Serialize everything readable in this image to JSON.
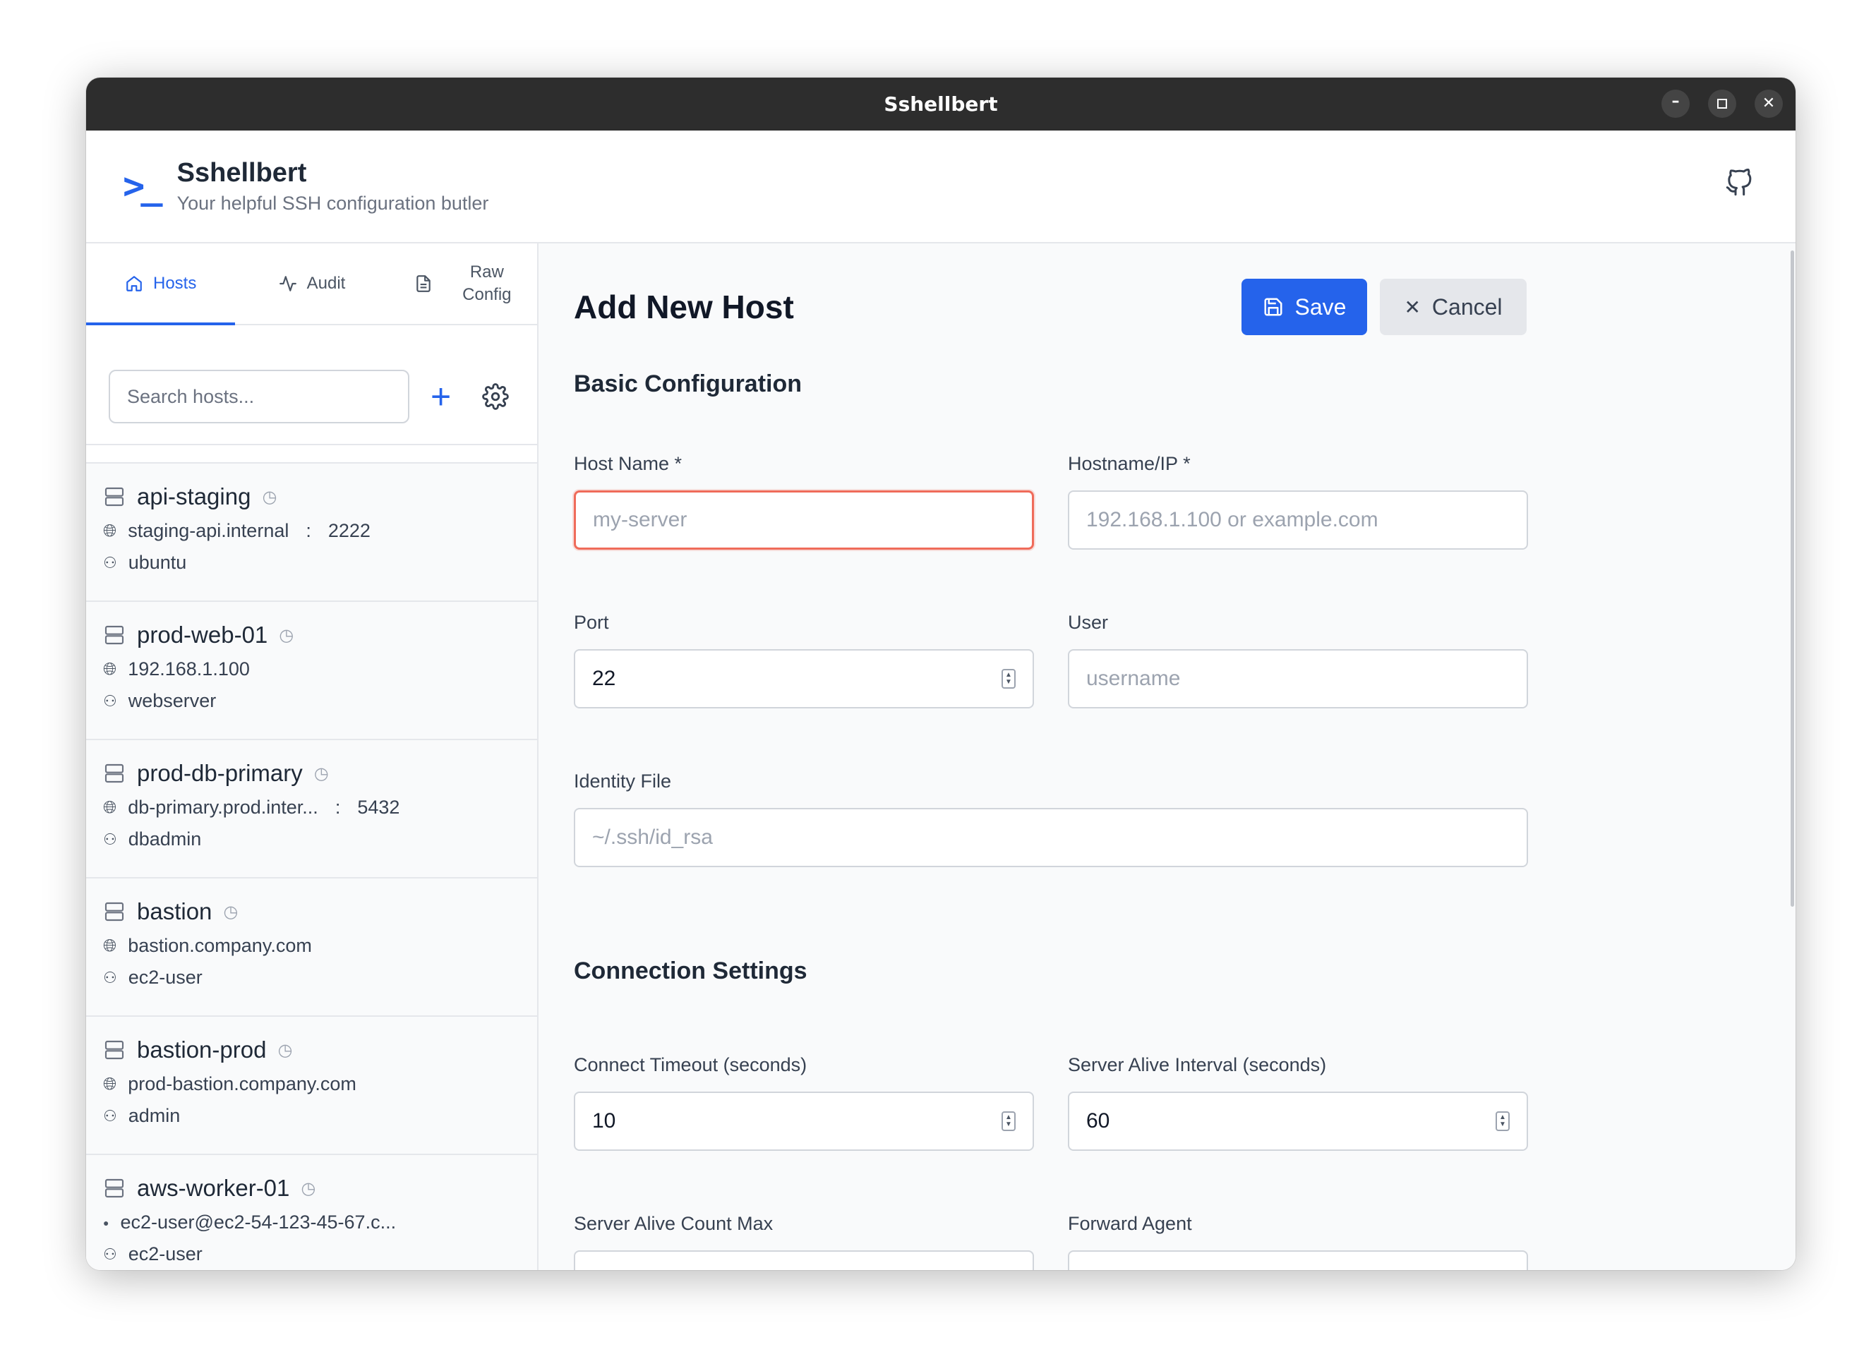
{
  "window": {
    "title": "Sshellbert"
  },
  "app": {
    "title": "Sshellbert",
    "subtitle": "Your helpful SSH configuration butler",
    "logo_icon": "terminal-prompt-icon",
    "github_icon": "github-icon"
  },
  "colors": {
    "accent": "#2563eb",
    "focus_ring": "#ef6b5a"
  },
  "sidebar": {
    "tabs": [
      {
        "label": "Hosts",
        "icon": "home-icon",
        "active": true
      },
      {
        "label": "Audit",
        "icon": "activity-icon",
        "active": false
      },
      {
        "label_line1": "Raw",
        "label_line2": "Config",
        "icon": "file-icon",
        "active": false
      }
    ],
    "search": {
      "placeholder": "Search hosts...",
      "value": ""
    },
    "hosts": [
      {
        "name": "api-staging",
        "address": "staging-api.internal",
        "port": "2222",
        "user": "ubuntu"
      },
      {
        "name": "prod-web-01",
        "address": "192.168.1.100",
        "port": "",
        "user": "webserver"
      },
      {
        "name": "prod-db-primary",
        "address": "db-primary.prod.inter...",
        "port": "5432",
        "user": "dbadmin"
      },
      {
        "name": "bastion",
        "address": "bastion.company.com",
        "port": "",
        "user": "ec2-user"
      },
      {
        "name": "bastion-prod",
        "address": "prod-bastion.company.com",
        "port": "",
        "user": "admin"
      },
      {
        "name": "aws-worker-01",
        "address": "ec2-user@ec2-54-123-45-67.c...",
        "port": "",
        "user": "ec2-user"
      }
    ]
  },
  "main": {
    "title": "Add New Host",
    "save_label": "Save",
    "cancel_label": "Cancel",
    "basic": {
      "title": "Basic Configuration",
      "host_name": {
        "label": "Host Name *",
        "placeholder": "my-server",
        "value": ""
      },
      "hostname_ip": {
        "label": "Hostname/IP *",
        "placeholder": "192.168.1.100 or example.com",
        "value": ""
      },
      "port": {
        "label": "Port",
        "value": "22"
      },
      "user": {
        "label": "User",
        "placeholder": "username",
        "value": ""
      },
      "identity_file": {
        "label": "Identity File",
        "placeholder": "~/.ssh/id_rsa",
        "value": ""
      }
    },
    "connection": {
      "title": "Connection Settings",
      "connect_timeout": {
        "label": "Connect Timeout (seconds)",
        "value": "10"
      },
      "server_alive_interval": {
        "label": "Server Alive Interval (seconds)",
        "value": "60"
      },
      "server_alive_count_max": {
        "label": "Server Alive Count Max"
      },
      "forward_agent": {
        "label": "Forward Agent"
      }
    }
  }
}
